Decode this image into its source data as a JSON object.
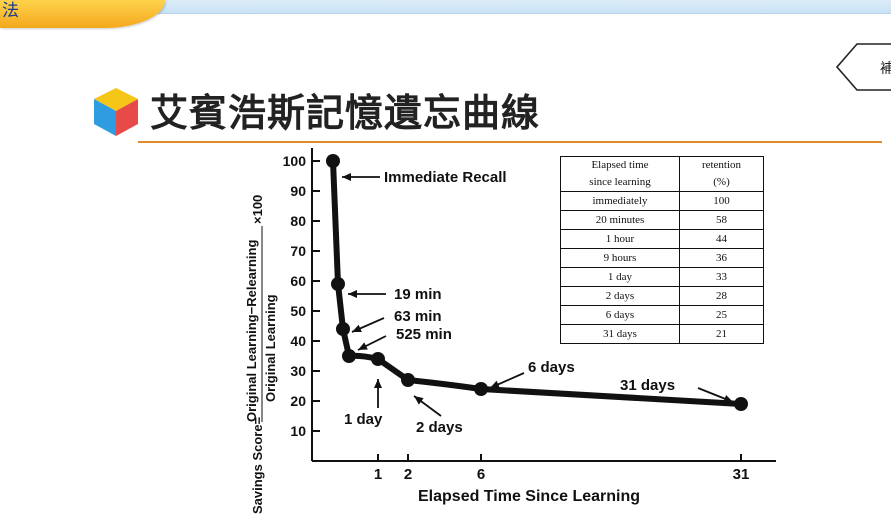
{
  "page": {
    "tab_label": "法",
    "nav_label": "補",
    "title": "艾賓浩斯記憶遺忘曲線"
  },
  "chart_data": {
    "type": "line",
    "ylabel_numerator": "Original Learning−Relearning",
    "ylabel_denominator": "Original Learning",
    "ylabel_prefix": "Savings Score=",
    "ylabel_suffix": "×100",
    "xlabel": "Elapsed Time Since Learning",
    "ylim": [
      0,
      105
    ],
    "y_ticks": [
      10,
      20,
      30,
      40,
      50,
      60,
      70,
      80,
      90,
      100
    ],
    "x_ticks": [
      "1",
      "2",
      "6",
      "31"
    ],
    "series": [
      {
        "points": [
          {
            "x": "immediately",
            "y": 100
          },
          {
            "x": "19 min",
            "y": 59
          },
          {
            "x": "63 min",
            "y": 44
          },
          {
            "x": "525 min",
            "y": 35
          },
          {
            "x": "1 day",
            "y": 34
          },
          {
            "x": "2 days",
            "y": 27
          },
          {
            "x": "6 days",
            "y": 24
          },
          {
            "x": "31 days",
            "y": 19
          }
        ]
      }
    ],
    "annotations": [
      {
        "text": "Immediate Recall",
        "point": 0
      },
      {
        "text": "19 min",
        "point": 1
      },
      {
        "text": "63 min",
        "point": 2
      },
      {
        "text": "525 min",
        "point": 3
      },
      {
        "text": "1 day",
        "point": 4
      },
      {
        "text": "2 days",
        "point": 5
      },
      {
        "text": "6 days",
        "point": 6
      },
      {
        "text": "31 days",
        "point": 7
      }
    ],
    "table": {
      "headers": [
        [
          "Elapsed time",
          "since learning"
        ],
        [
          "retention",
          "(%)"
        ]
      ],
      "rows": [
        [
          "immediately",
          "100"
        ],
        [
          "20 minutes",
          "58"
        ],
        [
          "1 hour",
          "44"
        ],
        [
          "9 hours",
          "36"
        ],
        [
          "1 day",
          "33"
        ],
        [
          "2 days",
          "28"
        ],
        [
          "6 days",
          "25"
        ],
        [
          "31 days",
          "21"
        ]
      ]
    }
  }
}
